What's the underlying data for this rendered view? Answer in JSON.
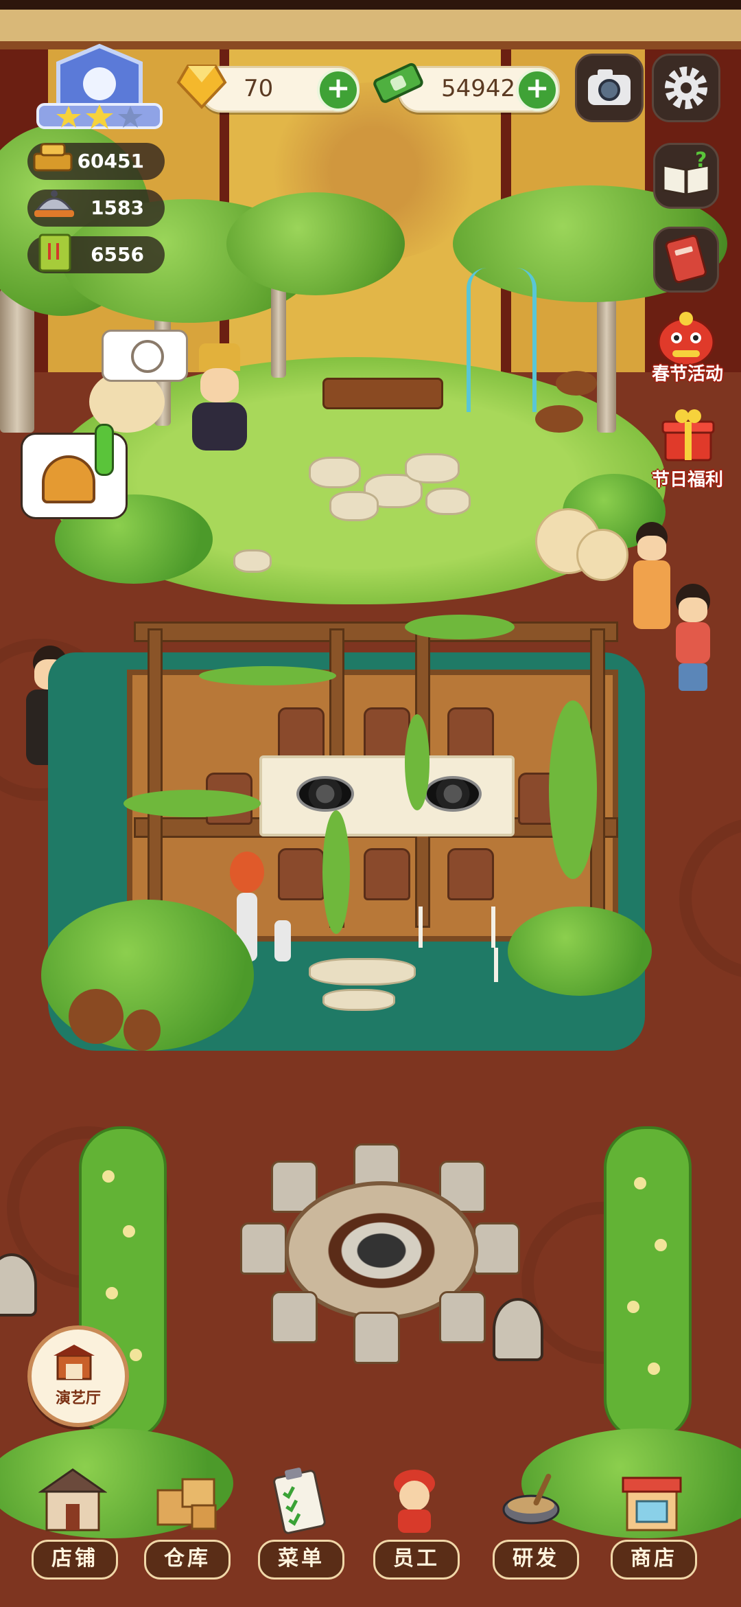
{
  "hud": {
    "level_stars": 2,
    "gems": {
      "value": "70",
      "icon": "gem-icon"
    },
    "cash": {
      "value": "54942",
      "icon": "cash-icon"
    },
    "camera_icon": "camera-icon",
    "settings_icon": "gear-icon"
  },
  "stats": [
    {
      "icon": "gold-ingot-icon",
      "value": "60451"
    },
    {
      "icon": "serving-dish-icon",
      "value": "1583"
    },
    {
      "icon": "menu-book-icon",
      "value": "6556"
    }
  ],
  "side_menu": {
    "help_icon": "help-book-icon",
    "recipe_icon": "red-book-icon",
    "spring_festival": {
      "label": "春节活动",
      "icon": "lion-dance-icon"
    },
    "holiday_welfare": {
      "label": "节日福利",
      "icon": "gift-box-icon"
    }
  },
  "theater": {
    "label": "演艺厅"
  },
  "nav": [
    {
      "label": "店铺",
      "icon": "shop-building-icon"
    },
    {
      "label": "仓库",
      "icon": "warehouse-boxes-icon"
    },
    {
      "label": "菜单",
      "icon": "clipboard-checklist-icon"
    },
    {
      "label": "员工",
      "icon": "staff-chef-icon"
    },
    {
      "label": "研发",
      "icon": "wok-icon"
    },
    {
      "label": "商店",
      "icon": "store-icon"
    }
  ],
  "colors": {
    "grass": "#8cc94a",
    "floor": "#7e3520",
    "accent_green": "#3fa236",
    "festival_red": "#c8251a"
  }
}
